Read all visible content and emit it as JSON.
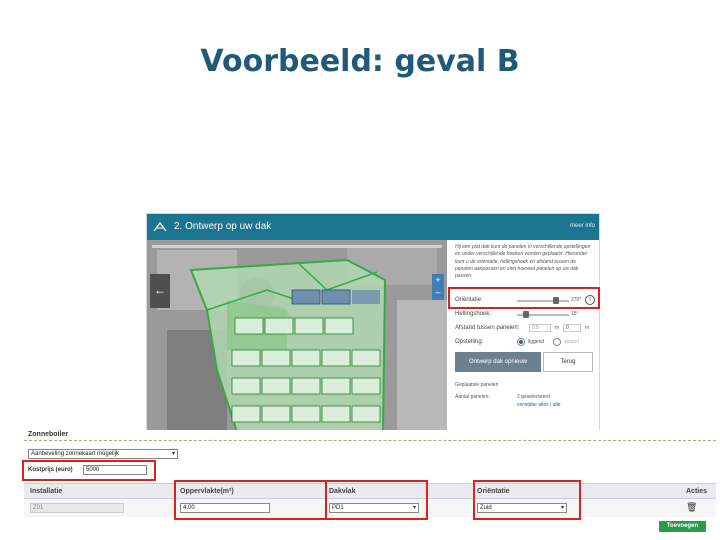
{
  "slide": {
    "title": "Voorbeeld: geval B"
  },
  "app": {
    "header_title": "2. Ontwerp op uw dak",
    "header_more": "meer info",
    "back_label": "←",
    "zoom_in": "+",
    "zoom_out": "–",
    "intro_text": "Hij een plat dak kunt de panelen in verschillende opstellingen en onder verschillende hoeken worden geplaatst. Hieronder kunt u de orientatie, hellingshoek en afstand tussen de panelen aanpassen en zien hoeveel panelen op uw dak passen.",
    "orientation_label": "Oriëntatie:",
    "orientation_value": "270°",
    "tilt_label": "Hellingshoek:",
    "tilt_value": "15°",
    "distance_label": "Afstand tussen panelen:",
    "distance_value": "0.5",
    "distance_unit": "m",
    "distance_value2": "0",
    "distance_unit2": "m",
    "setup_label": "Opstelling:",
    "setup_option1": "liggend",
    "setup_option2": "staand",
    "btn_primary": "Ontwerp dak opnieuw",
    "btn_secondary": "Terug",
    "placed_heading": "Geplaatste panelen",
    "count_label": "Aantal panelen:",
    "count_value": "2 geselecteerd",
    "links": "verwijder alles | alle"
  },
  "form": {
    "title": "Zonneboiler",
    "recommend_select": "Aanbeveling zonnekaart mogelijk",
    "cost_label": "Kostprijs (euro)",
    "cost_value": "5000",
    "columns": [
      "Installatie",
      "Oppervlakte(m²)",
      "Dakvlak",
      "Oriëntatie",
      "Acties"
    ],
    "row": {
      "installatie": "Z01",
      "oppervlakte": "4,00",
      "dakvlak": "PD1",
      "orientatie": "Zuid"
    },
    "add_button": "Toevoegen"
  },
  "colors": {
    "title": "#1f5a78",
    "header": "#1b7590",
    "highlight": "#e0201f",
    "add_button": "#2a9b48"
  }
}
